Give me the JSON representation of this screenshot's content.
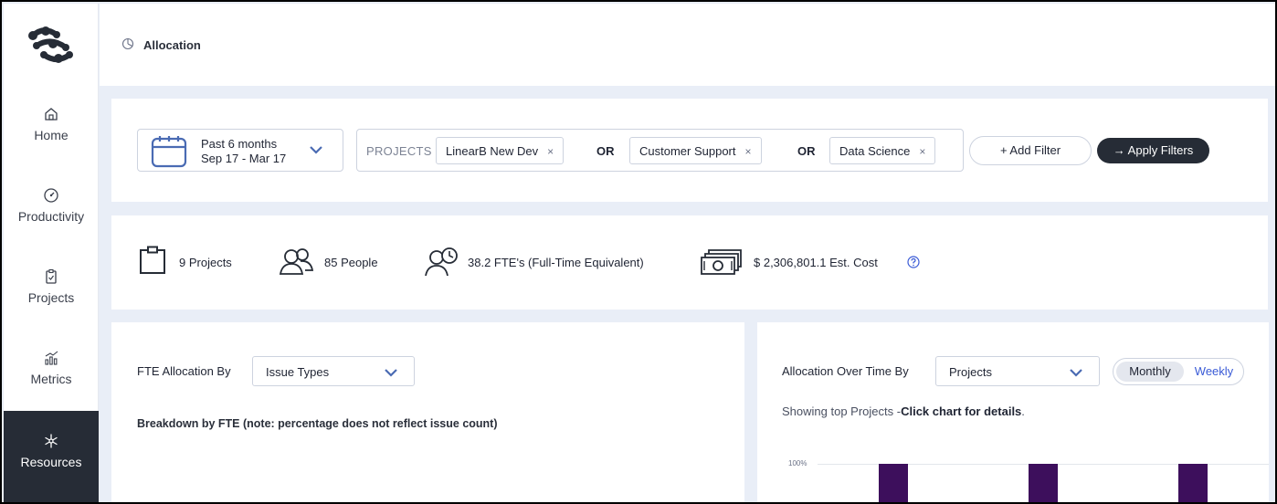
{
  "sidebar": {
    "items": [
      {
        "label": "Home",
        "icon": "home-icon"
      },
      {
        "label": "Productivity",
        "icon": "gauge-icon"
      },
      {
        "label": "Projects",
        "icon": "clipboard-icon"
      },
      {
        "label": "Metrics",
        "icon": "chart-icon"
      },
      {
        "label": "Resources",
        "icon": "snowflake-icon",
        "active": true
      }
    ]
  },
  "header": {
    "title": "Allocation"
  },
  "filters": {
    "date_range": {
      "label": "Past 6 months",
      "range": "Sep 17 - Mar 17"
    },
    "projects_label": "PROJECTS",
    "chips": [
      "LinearB New Dev",
      "Customer Support",
      "Data Science"
    ],
    "or_label": "OR",
    "chip_close": "×",
    "add_filter": "+ Add Filter",
    "apply_filters": "→ Apply Filters"
  },
  "stats": {
    "projects": "9 Projects",
    "people": "85 People",
    "fte": "38.2 FTE's (Full-Time Equivalent)",
    "cost": "$ 2,306,801.1 Est. Cost"
  },
  "fte_panel": {
    "label": "FTE Allocation By",
    "selected": "Issue Types",
    "breakdown": "Breakdown by FTE (note: percentage does not reflect issue count)"
  },
  "time_panel": {
    "label": "Allocation Over Time By",
    "selected": "Projects",
    "toggle": {
      "monthly": "Monthly",
      "weekly": "Weekly",
      "active": "Monthly"
    },
    "showing_prefix": "Showing top Projects -",
    "showing_bold": "Click chart for details",
    "showing_suffix": "."
  },
  "chart_data": {
    "type": "bar",
    "ytick": "100%",
    "bar_color": "#3d0f5c"
  },
  "colors": {
    "accent": "#262c36",
    "link": "#3a5bd6",
    "background": "#e9eef7"
  }
}
